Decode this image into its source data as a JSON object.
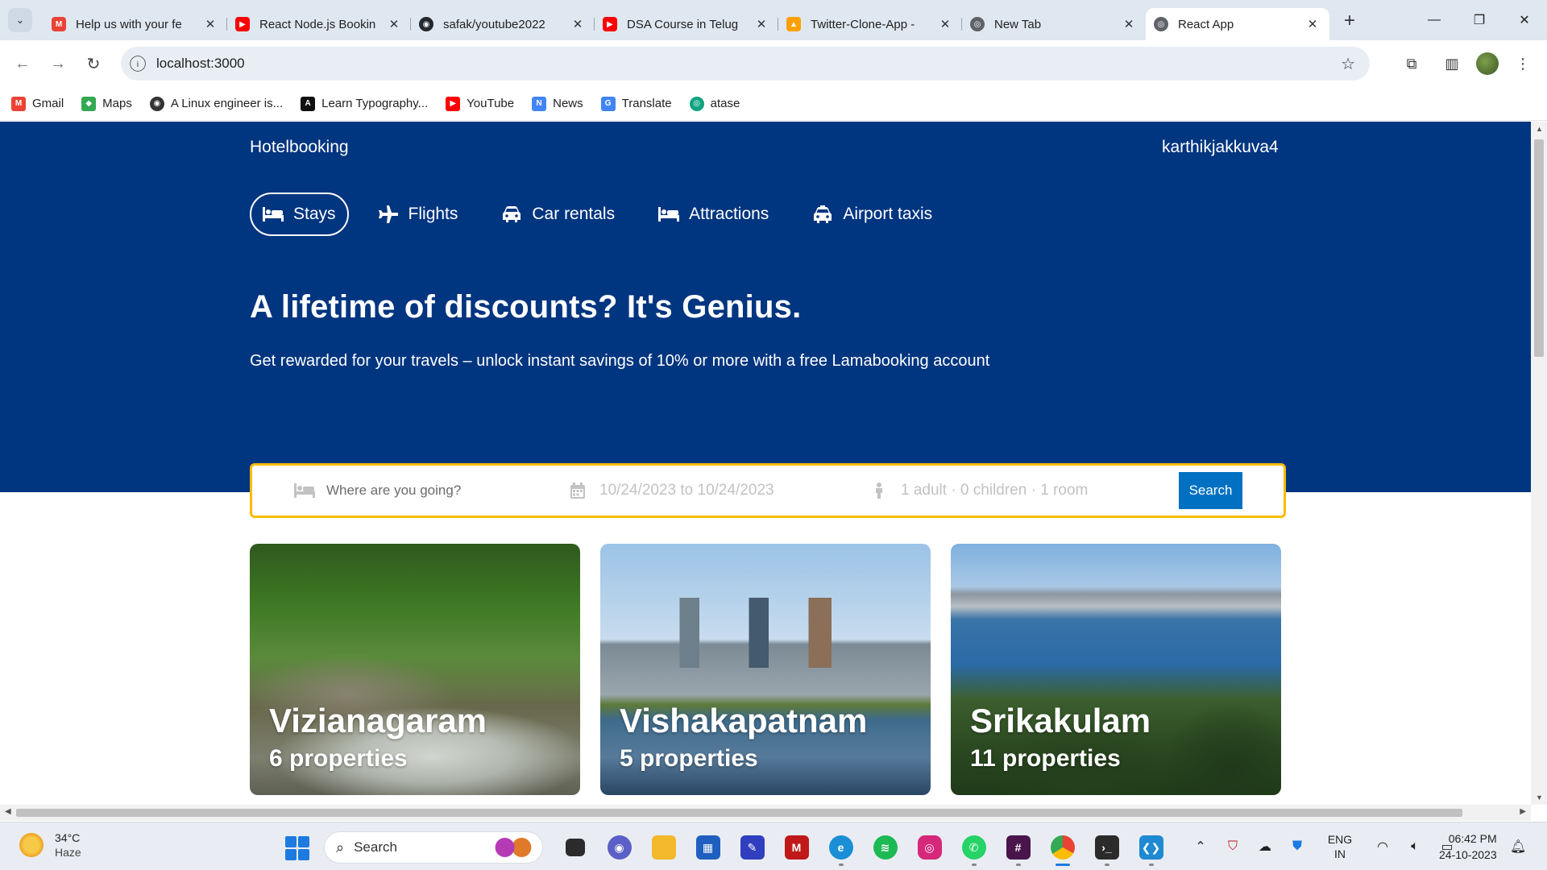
{
  "browser": {
    "tabs": [
      {
        "title": "Help us with your fe",
        "favicon": "gmail-icon",
        "color": "#ea4335",
        "glyph": "M"
      },
      {
        "title": "React Node.js Bookin",
        "favicon": "youtube-icon",
        "color": "#ff0000",
        "glyph": "▶"
      },
      {
        "title": "safak/youtube2022",
        "favicon": "github-icon",
        "color": "#24292f",
        "glyph": "◉"
      },
      {
        "title": "DSA Course in Telug",
        "favicon": "youtube-icon",
        "color": "#ff0000",
        "glyph": "▶"
      },
      {
        "title": "Twitter-Clone-App -",
        "favicon": "firebase-icon",
        "color": "#ffa000",
        "glyph": "▲"
      },
      {
        "title": "New Tab",
        "favicon": "chrome-icon",
        "color": "#5f6368",
        "glyph": "◎"
      },
      {
        "title": "React App",
        "favicon": "globe-icon",
        "color": "#5f6368",
        "glyph": "◎"
      }
    ],
    "address": "localhost:3000",
    "bookmarks": [
      {
        "label": "Gmail",
        "icon": "gmail-icon",
        "color": "#ea4335",
        "glyph": "M"
      },
      {
        "label": "Maps",
        "icon": "maps-icon",
        "color": "#34a853",
        "glyph": "◆"
      },
      {
        "label": "A Linux engineer is...",
        "icon": "globe-icon",
        "color": "#333333",
        "glyph": "◉"
      },
      {
        "label": "Learn Typography...",
        "icon": "typography-icon",
        "color": "#111111",
        "glyph": "A"
      },
      {
        "label": "YouTube",
        "icon": "youtube-icon",
        "color": "#ff0000",
        "glyph": "▶"
      },
      {
        "label": "News",
        "icon": "news-icon",
        "color": "#4285f4",
        "glyph": "N"
      },
      {
        "label": "Translate",
        "icon": "translate-icon",
        "color": "#4285f4",
        "glyph": "G"
      },
      {
        "label": "atase",
        "icon": "openai-icon",
        "color": "#10a37f",
        "glyph": "◎"
      }
    ]
  },
  "site": {
    "logo": "Hotelbooking",
    "username": "karthikjakkuva4",
    "nav": [
      {
        "label": "Stays",
        "icon": "bed-icon",
        "active": true
      },
      {
        "label": "Flights",
        "icon": "plane-icon",
        "active": false
      },
      {
        "label": "Car rentals",
        "icon": "car-icon",
        "active": false
      },
      {
        "label": "Attractions",
        "icon": "bed-icon",
        "active": false
      },
      {
        "label": "Airport taxis",
        "icon": "taxi-icon",
        "active": false
      }
    ],
    "hero_title": "A lifetime of discounts? It's Genius.",
    "hero_desc": "Get rewarded for your travels – unlock instant savings of 10% or more with a free Lamabooking account",
    "search": {
      "destination_placeholder": "Where are you going?",
      "dates": "10/24/2023 to 10/24/2023",
      "guests": "1 adult · 0 children · 1 room",
      "button": "Search"
    },
    "featured": [
      {
        "city": "Vizianagaram",
        "properties": "6 properties"
      },
      {
        "city": "Vishakapatnam",
        "properties": "5 properties"
      },
      {
        "city": "Srikakulam",
        "properties": "11 properties"
      }
    ]
  },
  "taskbar": {
    "temperature": "34°C",
    "condition": "Haze",
    "search_label": "Search",
    "lang_top": "ENG",
    "lang_bottom": "IN",
    "time": "06:42 PM",
    "date": "24-10-2023"
  },
  "colors": {
    "hero": "#003580",
    "search_border": "#febb02",
    "search_button": "#0071c2"
  }
}
